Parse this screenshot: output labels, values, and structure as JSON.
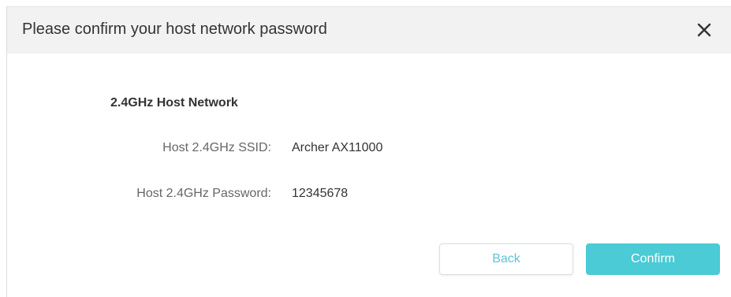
{
  "dialog": {
    "title": "Please confirm your host network password",
    "close_icon": "close-icon"
  },
  "section": {
    "title": "2.4GHz Host Network",
    "fields": [
      {
        "label": "Host 2.4GHz SSID:",
        "value": "Archer AX11000"
      },
      {
        "label": "Host 2.4GHz Password:",
        "value": "12345678"
      }
    ]
  },
  "buttons": {
    "back_label": "Back",
    "confirm_label": "Confirm"
  },
  "colors": {
    "accent": "#4acbd6",
    "header_bg": "#f2f2f2",
    "text_primary": "#333333",
    "text_secondary": "#666666"
  }
}
